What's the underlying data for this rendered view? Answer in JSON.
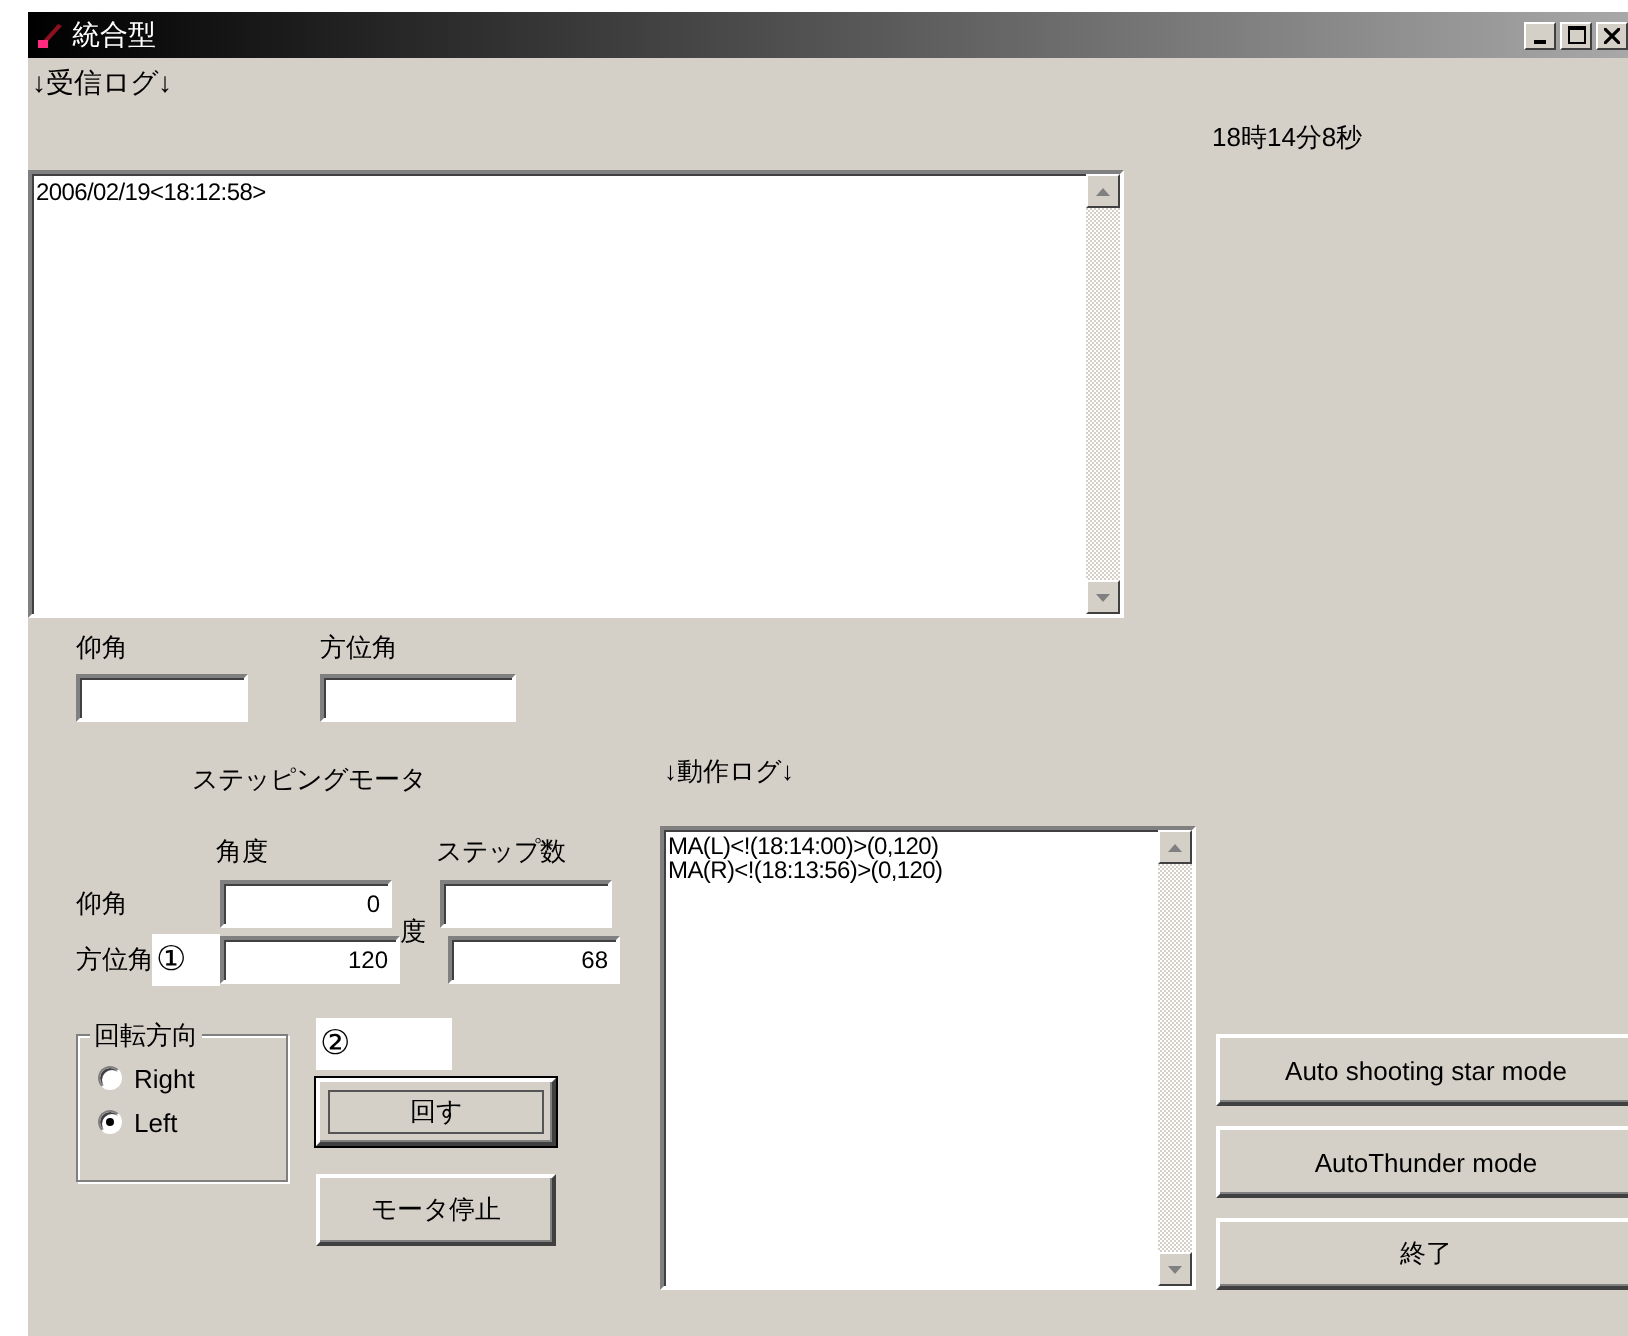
{
  "window": {
    "title": "統合型"
  },
  "receive_log": {
    "label": "↓受信ログ↓",
    "lines": [
      "2006/02/19<18:12:58>"
    ]
  },
  "clock": "18時14分8秒",
  "angle_inputs": [
    {
      "label": "仰角"
    },
    {
      "label": "方位角"
    }
  ],
  "stepping_motor": {
    "title": "ステッピングモータ",
    "columns": [
      "角度",
      "ステップ数"
    ],
    "unit": "度",
    "rows": [
      {
        "label": "仰角",
        "angle": "0"
      },
      {
        "label": "方位角",
        "angle": "120",
        "steps": "68"
      }
    ]
  },
  "annotations": [
    "①",
    "②"
  ],
  "rotation": {
    "title": "回転方向",
    "options": [
      {
        "label": "Right",
        "selected": false
      },
      {
        "label": "Left",
        "selected": true
      }
    ]
  },
  "motor_buttons": [
    {
      "label": "回す",
      "focused": true
    },
    {
      "label": "モータ停止",
      "focused": false
    }
  ],
  "action_log": {
    "label": "↓動作ログ↓",
    "lines": [
      "MA(L)<!(18:14:00)>(0,120)",
      "MA(R)<!(18:13:56)>(0,120)"
    ]
  },
  "mode_buttons": [
    {
      "label": "Auto shooting star mode"
    },
    {
      "label": "AutoThunder mode"
    },
    {
      "label": "終了"
    }
  ]
}
